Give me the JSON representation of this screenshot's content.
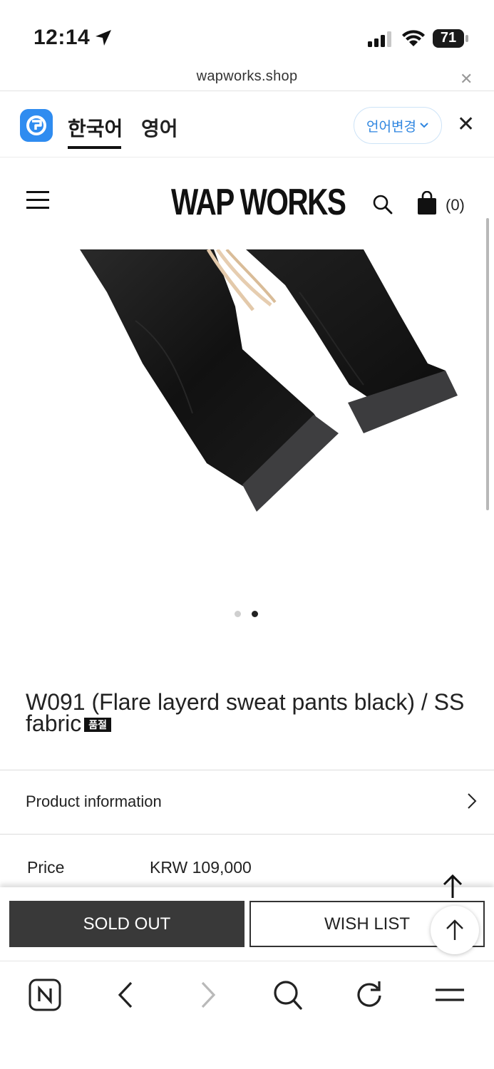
{
  "status_bar": {
    "time": "12:14",
    "battery": "71"
  },
  "browser": {
    "url": "wapworks.shop"
  },
  "translate_bar": {
    "lang_source": "한국어",
    "lang_target": "영어",
    "change_language": "언어변경"
  },
  "header": {
    "logo": "WAP WORKS",
    "cart_count": "(0)"
  },
  "gallery": {
    "slides": 2,
    "active_slide": 2
  },
  "product": {
    "title": "W091 (Flare layerd sweat pants black) / SS fabric",
    "sold_tag": "품절",
    "info_label": "Product information",
    "price_label": "Price",
    "price_value": "KRW 109,000"
  },
  "actions": {
    "sold_out": "SOLD OUT",
    "wish_list": "WISH LIST"
  },
  "colors": {
    "accent_blue": "#2f86e0",
    "papago_blue": "#2f8cf0",
    "sold_out_bg": "#393939"
  }
}
